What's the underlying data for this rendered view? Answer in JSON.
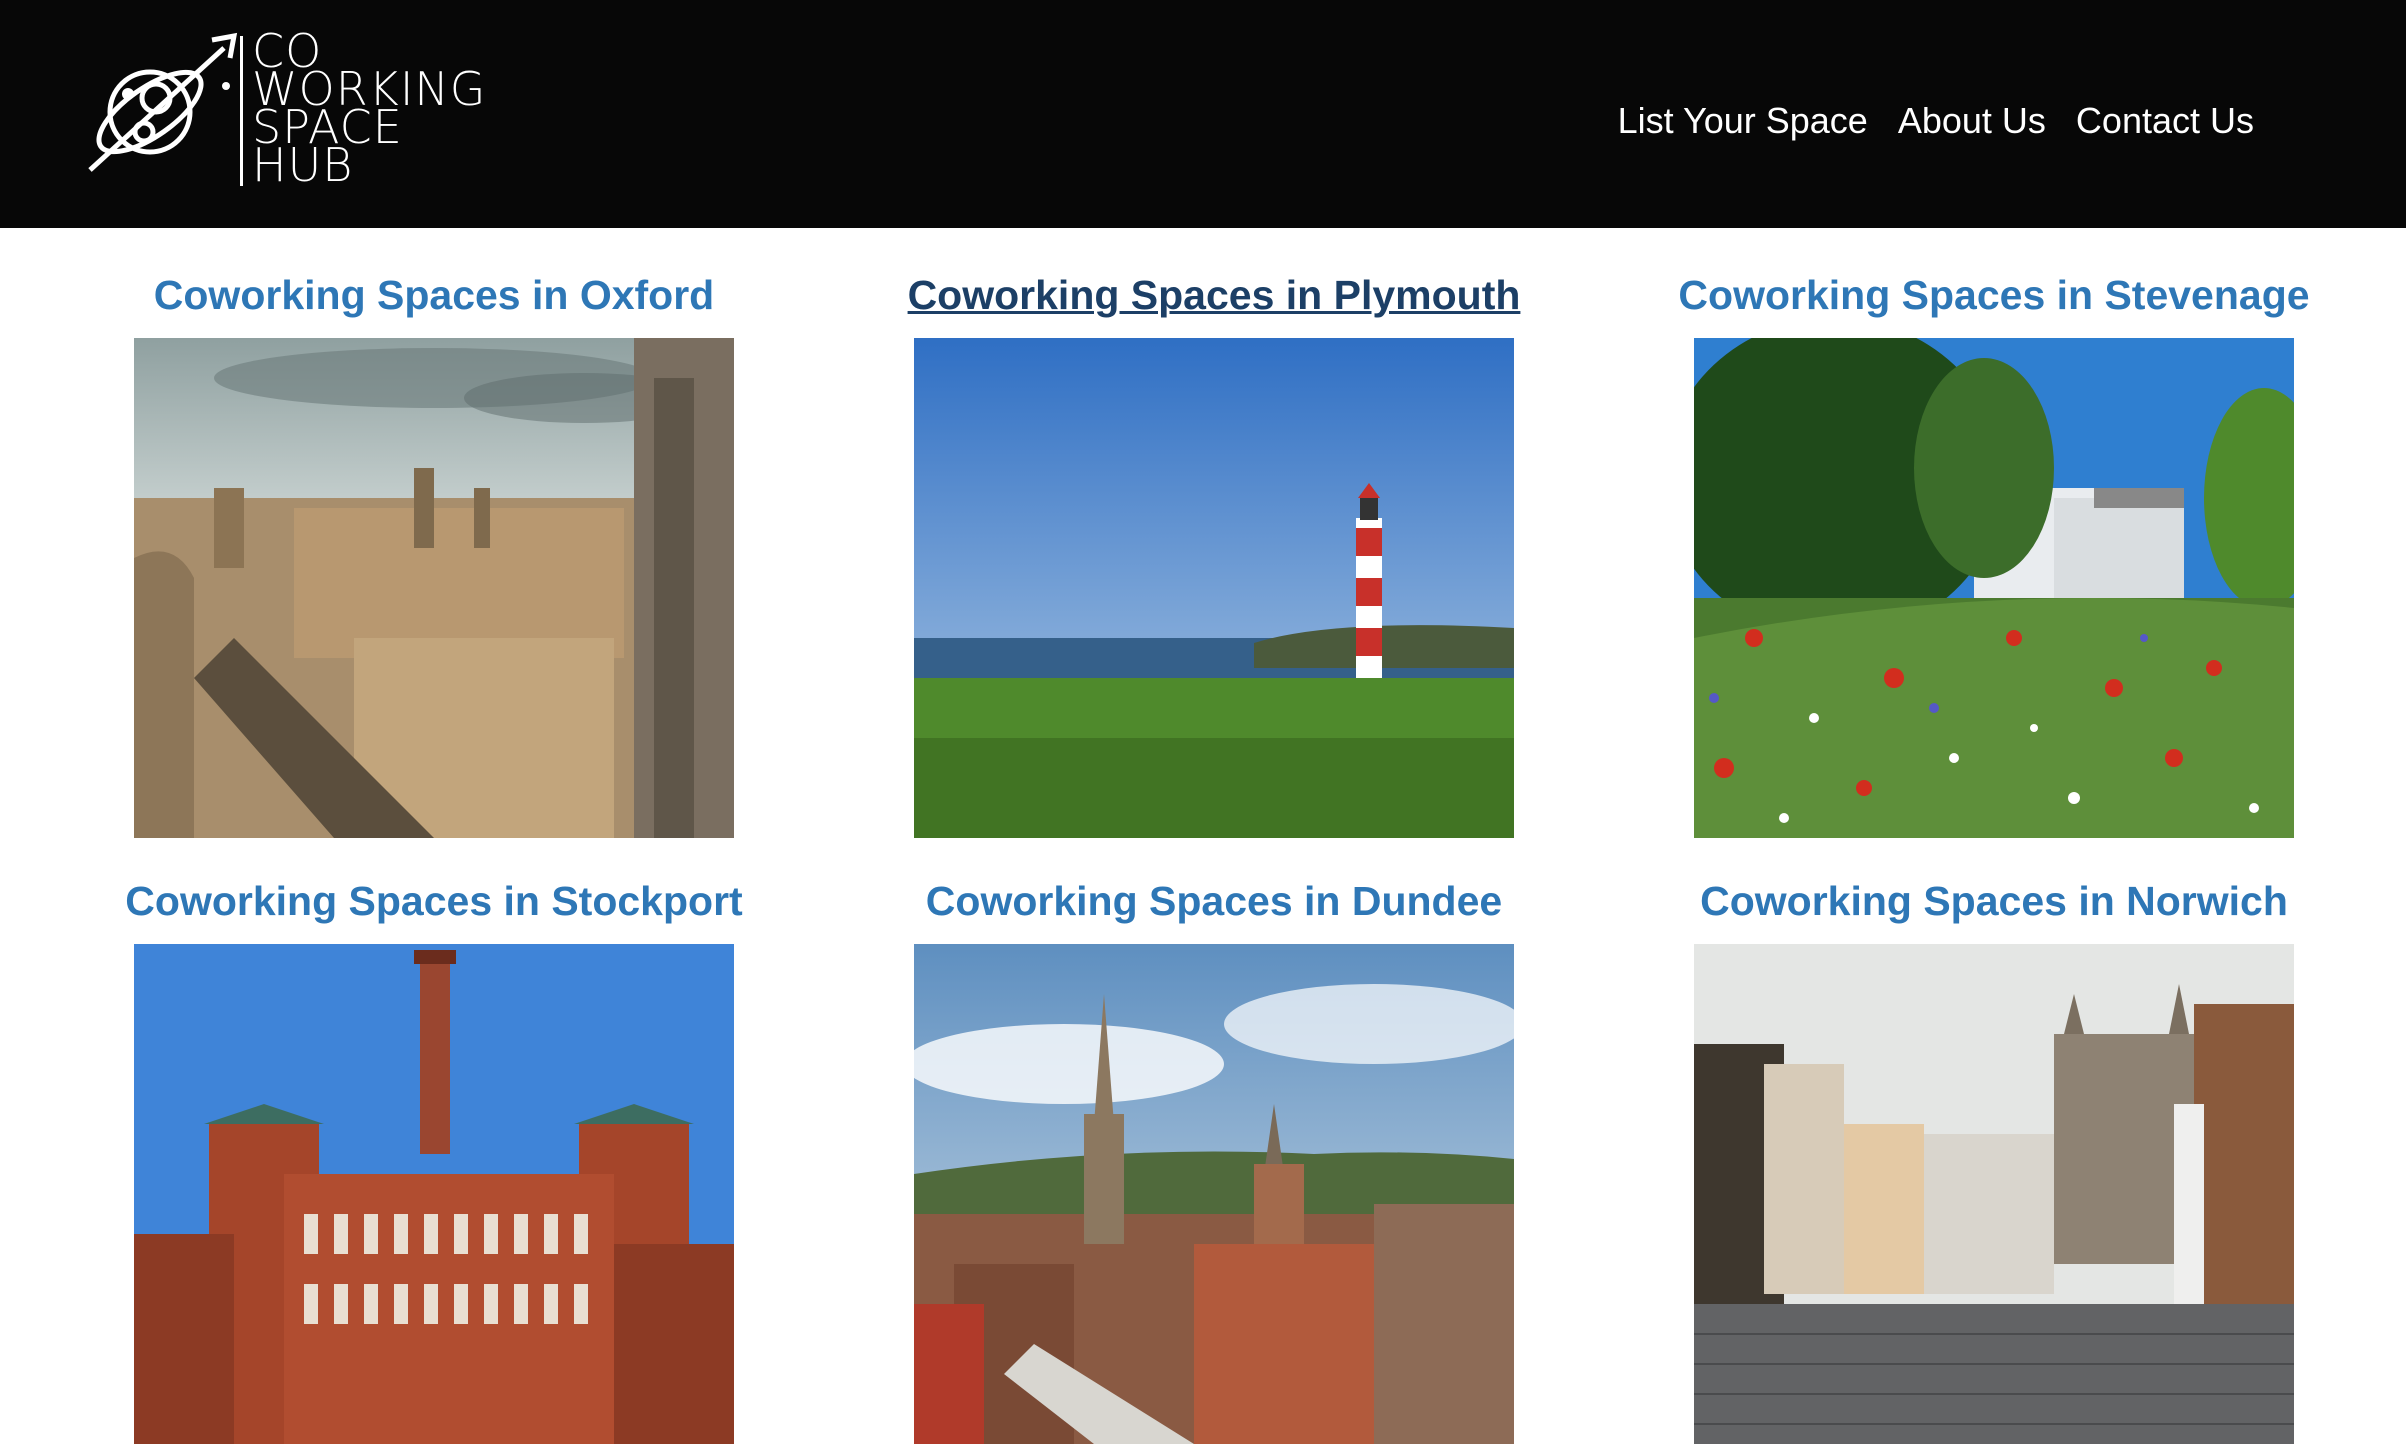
{
  "header": {
    "logo_lines": [
      "CO",
      "WORKING",
      "SPACE",
      "HUB"
    ],
    "nav": [
      "List Your Space",
      "About Us",
      "Contact Us"
    ]
  },
  "cities": [
    {
      "title": "Coworking Spaces in Oxford",
      "image": "oxford-skyline-photo"
    },
    {
      "title": "Coworking Spaces in Plymouth",
      "image": "plymouth-lighthouse-photo",
      "hover": true
    },
    {
      "title": "Coworking Spaces in Stevenage",
      "image": "stevenage-wildflowers-photo"
    },
    {
      "title": "Coworking Spaces in Stockport",
      "image": "stockport-mill-photo"
    },
    {
      "title": "Coworking Spaces in Dundee",
      "image": "dundee-city-photo"
    },
    {
      "title": "Coworking Spaces in Norwich",
      "image": "norwich-street-photo"
    }
  ],
  "colors": {
    "link": "#2e77b6",
    "link_hover": "#1c3f66",
    "header_bg": "#070707"
  }
}
